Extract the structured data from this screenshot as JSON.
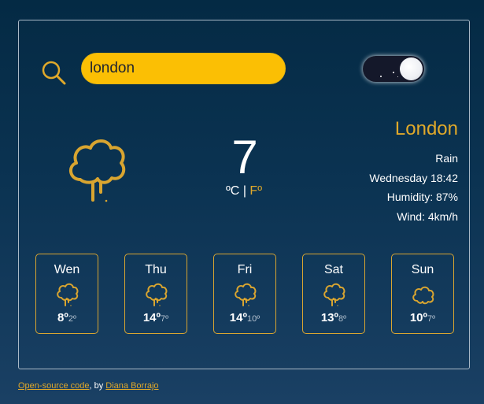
{
  "search": {
    "value": "london"
  },
  "theme_toggle": {
    "state": "dark"
  },
  "current": {
    "icon": "rain-cloud-icon",
    "temperature": "7",
    "unit_active": "ºC",
    "unit_separator": "|",
    "unit_alt": "Fº",
    "city": "London",
    "description": "Rain",
    "datetime": "Wednesday 18:42",
    "humidity": "Humidity: 87%",
    "wind": "Wind: 4km/h"
  },
  "forecast": [
    {
      "day": "Wen",
      "max": "8º",
      "min": "2º",
      "icon": "rain-cloud-icon"
    },
    {
      "day": "Thu",
      "max": "14º",
      "min": "7º",
      "icon": "rain-cloud-icon"
    },
    {
      "day": "Fri",
      "max": "14º",
      "min": "10º",
      "icon": "rain-cloud-icon"
    },
    {
      "day": "Sat",
      "max": "13º",
      "min": "8º",
      "icon": "rain-cloud-icon"
    },
    {
      "day": "Sun",
      "max": "10º",
      "min": "7º",
      "icon": "cloud-icon"
    }
  ],
  "footer": {
    "link_text": "Open-source code",
    "middle": ", by ",
    "author": "Diana Borrajo"
  },
  "colors": {
    "accent": "#e0a92a",
    "input_bg": "#fbbf04",
    "background": "#0b3352"
  }
}
